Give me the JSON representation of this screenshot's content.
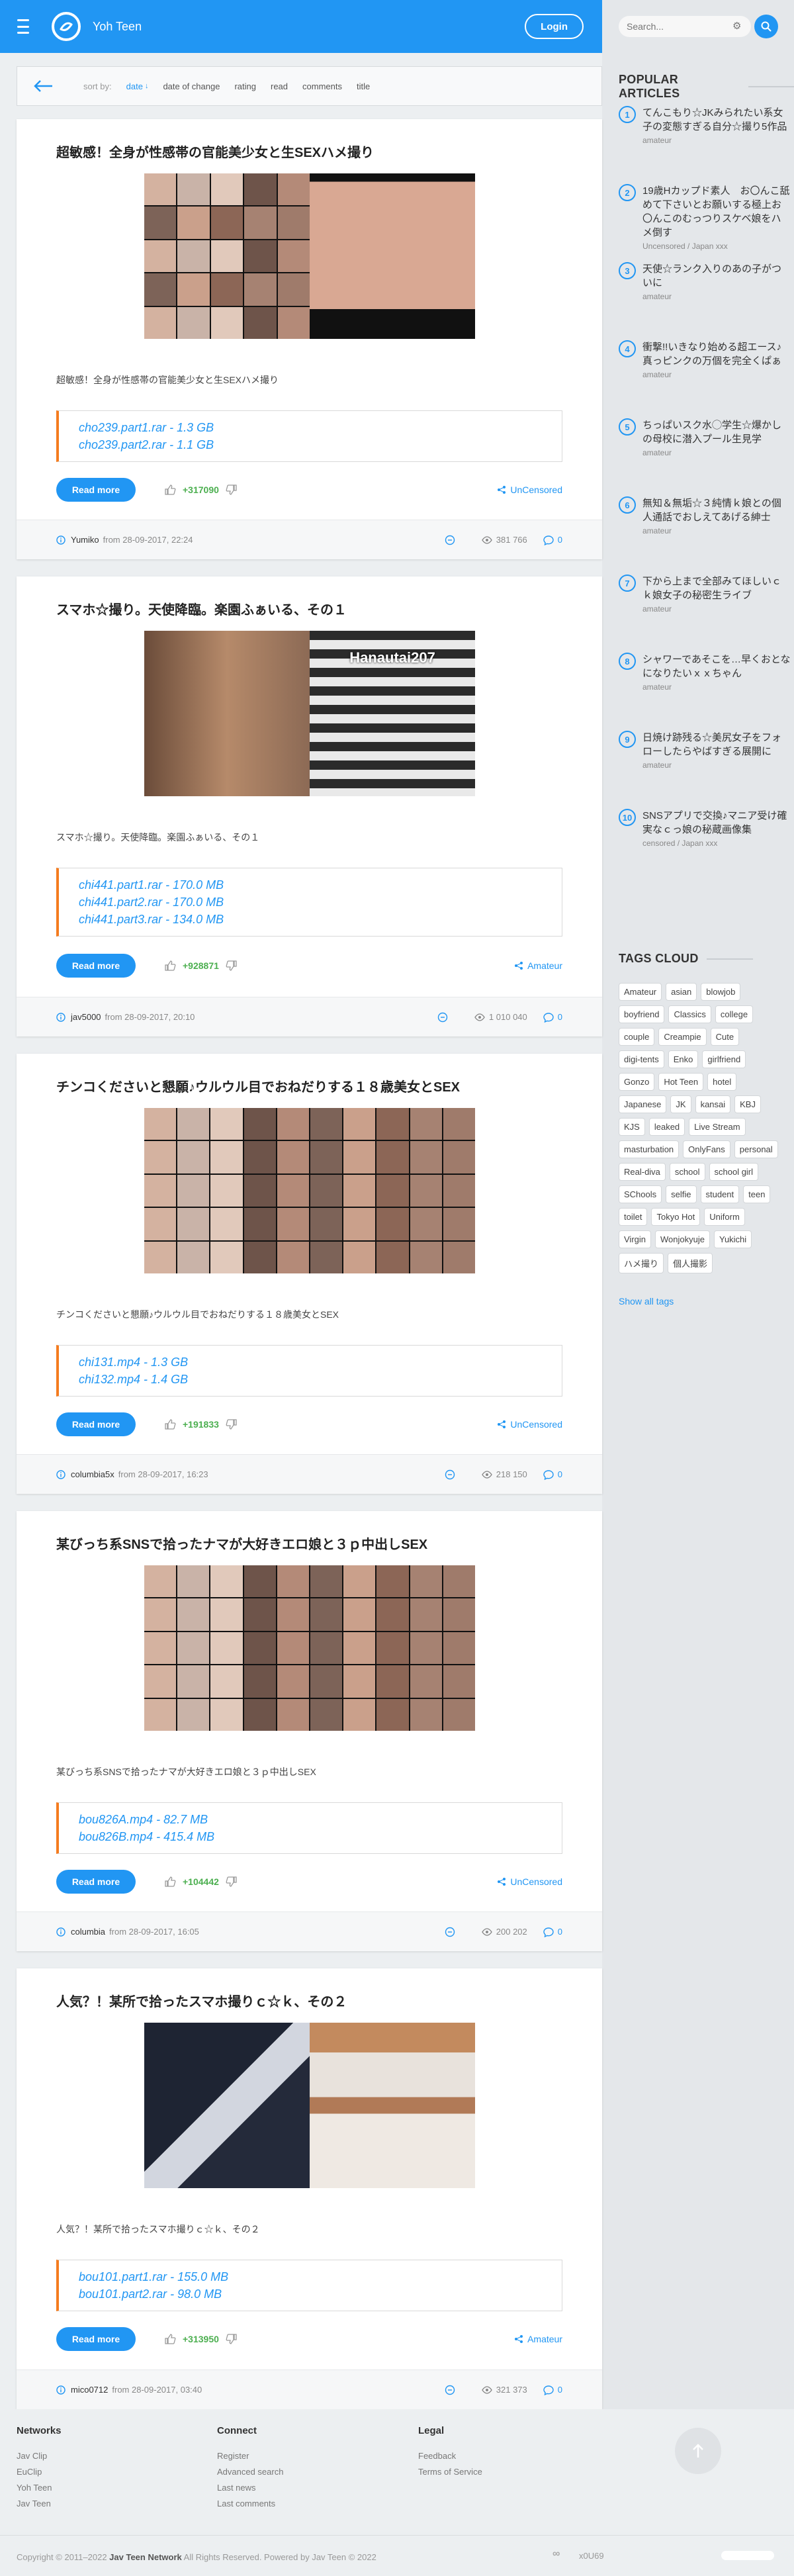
{
  "header": {
    "site_name": "Yoh Teen",
    "login_label": "Login"
  },
  "search": {
    "placeholder": "Search..."
  },
  "sortbar": {
    "label": "sort by:",
    "items": [
      "date",
      "date of change",
      "rating",
      "read",
      "comments",
      "title"
    ]
  },
  "articles": [
    {
      "title": "超敏感！全身が性感帯の官能美少女と生SEXハメ撮り",
      "desc": "超敏感！全身が性感帯の官能美少女と生SEXハメ撮り",
      "files": [
        "cho239.part1.rar - 1.3 GB",
        "cho239.part2.rar - 1.1 GB"
      ],
      "more": "Read more",
      "votes": "+317090",
      "category": "UnCensored",
      "author": "Yumiko",
      "date": "from 28-09-2017, 22:24",
      "views": "381 766",
      "comments": "0"
    },
    {
      "title": "スマホ☆撮り。天使降臨。楽園ふぁいる、その１",
      "desc": "スマホ☆撮り。天使降臨。楽園ふぁいる、その１",
      "files": [
        "chi441.part1.rar - 170.0 MB",
        "chi441.part2.rar - 170.0 MB",
        "chi441.part3.rar - 134.0 MB"
      ],
      "more": "Read more",
      "votes": "+928871",
      "category": "Amateur",
      "author": "jav5000",
      "date": "from 28-09-2017, 20:10",
      "views": "1 010 040",
      "comments": "0",
      "watermark": "Hanautai207"
    },
    {
      "title": "チンコくださいと懇願♪ウルウル目でおねだりする１８歳美女とSEX",
      "desc": "チンコくださいと懇願♪ウルウル目でおねだりする１８歳美女とSEX",
      "files": [
        "chi131.mp4 - 1.3 GB",
        "chi132.mp4 - 1.4 GB"
      ],
      "more": "Read more",
      "votes": "+191833",
      "category": "UnCensored",
      "author": "columbia5x",
      "date": "from 28-09-2017, 16:23",
      "views": "218 150",
      "comments": "0"
    },
    {
      "title": "某びっち系SNSで拾ったナマが大好きエロ娘と３ｐ中出しSEX",
      "desc": "某びっち系SNSで拾ったナマが大好きエロ娘と３ｐ中出しSEX",
      "files": [
        "bou826A.mp4 - 82.7 MB",
        "bou826B.mp4 - 415.4 MB"
      ],
      "more": "Read more",
      "votes": "+104442",
      "category": "UnCensored",
      "author": "columbia",
      "date": "from 28-09-2017, 16:05",
      "views": "200 202",
      "comments": "0"
    },
    {
      "title": "人気？！某所で拾ったスマホ撮りｃ☆ｋ、その２",
      "desc": "人気？！某所で拾ったスマホ撮りｃ☆ｋ、その２",
      "files": [
        "bou101.part1.rar - 155.0 MB",
        "bou101.part2.rar - 98.0 MB"
      ],
      "more": "Read more",
      "votes": "+313950",
      "category": "Amateur",
      "author": "mico0712",
      "date": "from 28-09-2017, 03:40",
      "views": "321 373",
      "comments": "0"
    }
  ],
  "sidebar": {
    "popular_title": "POPULAR ARTICLES",
    "popular": [
      {
        "n": "1",
        "title": "てんこもり☆JKみられたい系女子の変態すぎる自分☆撮り5作品",
        "cat": "amateur"
      },
      {
        "n": "2",
        "title": "19歳Hカップド素人　お〇んこ舐めて下さいとお願いする極上お〇んこのむっつりスケベ娘をハメ倒す",
        "cat": "Uncensored / Japan xxx"
      },
      {
        "n": "3",
        "title": "天使☆ランク入りのあの子がついに",
        "cat": "amateur"
      },
      {
        "n": "4",
        "title": "衝撃!!いきなり始める超エース♪真っピンクの万個を完全くぱぁ",
        "cat": "amateur"
      },
      {
        "n": "5",
        "title": "ちっぱいスク水◯学生☆爆かしの母校に潜入プール生見学",
        "cat": "amateur"
      },
      {
        "n": "6",
        "title": "無知＆無垢☆３純情ｋ娘との個人通話でおしえてあげる紳士",
        "cat": "amateur"
      },
      {
        "n": "7",
        "title": "下から上まで全部みてほしいｃｋ娘女子の秘密生ライブ",
        "cat": "amateur"
      },
      {
        "n": "8",
        "title": "シャワーであそこを…早くおとなになりたいｘｘちゃん",
        "cat": "amateur"
      },
      {
        "n": "9",
        "title": "日焼け跡残る☆美尻女子をフォローしたらやばすぎる展開に",
        "cat": "amateur"
      },
      {
        "n": "10",
        "title": "SNSアプリで交換♪マニア受け確実なｃっ娘の秘蔵画像集",
        "cat": "censored / Japan xxx"
      }
    ],
    "tags_title": "TAGS CLOUD",
    "tags": [
      "Amateur",
      "asian",
      "blowjob",
      "boyfriend",
      "Classics",
      "college",
      "couple",
      "Creampie",
      "Cute",
      "digi-tents",
      "Enko",
      "girlfriend",
      "Gonzo",
      "Hot Teen",
      "hotel",
      "Japanese",
      "JK",
      "kansai",
      "KBJ",
      "KJS",
      "leaked",
      "Live Stream",
      "masturbation",
      "OnlyFans",
      "personal",
      "Real-diva",
      "school",
      "school girl",
      "SChools",
      "selfie",
      "student",
      "teen",
      "toilet",
      "Tokyo Hot",
      "Uniform",
      "Virgin",
      "Wonjokyuje",
      "Yukichi",
      "ハメ撮り",
      "個人撮影"
    ],
    "show_all": "Show all tags"
  },
  "footer": {
    "networks_title": "Networks",
    "networks": [
      "Jav Clip",
      "EuClip",
      "Yoh Teen",
      "Jav Teen"
    ],
    "connect_title": "Connect",
    "connect": [
      "Register",
      "Advanced search",
      "Last news",
      "Last comments"
    ],
    "legal_title": "Legal",
    "legal": [
      "Feedback",
      "Terms of Service"
    ],
    "copyright_prefix": "Copyright © 2011–2022",
    "network_name": "Jav Teen Network",
    "copyright_suffix": "All Rights Reserved. Powered by Jav Teen © 2022",
    "logo_text": "∞",
    "user": "x0U69"
  },
  "colors": {
    "primary": "#2196f3",
    "accent": "#f57c1f",
    "vote": "#4caf50"
  }
}
